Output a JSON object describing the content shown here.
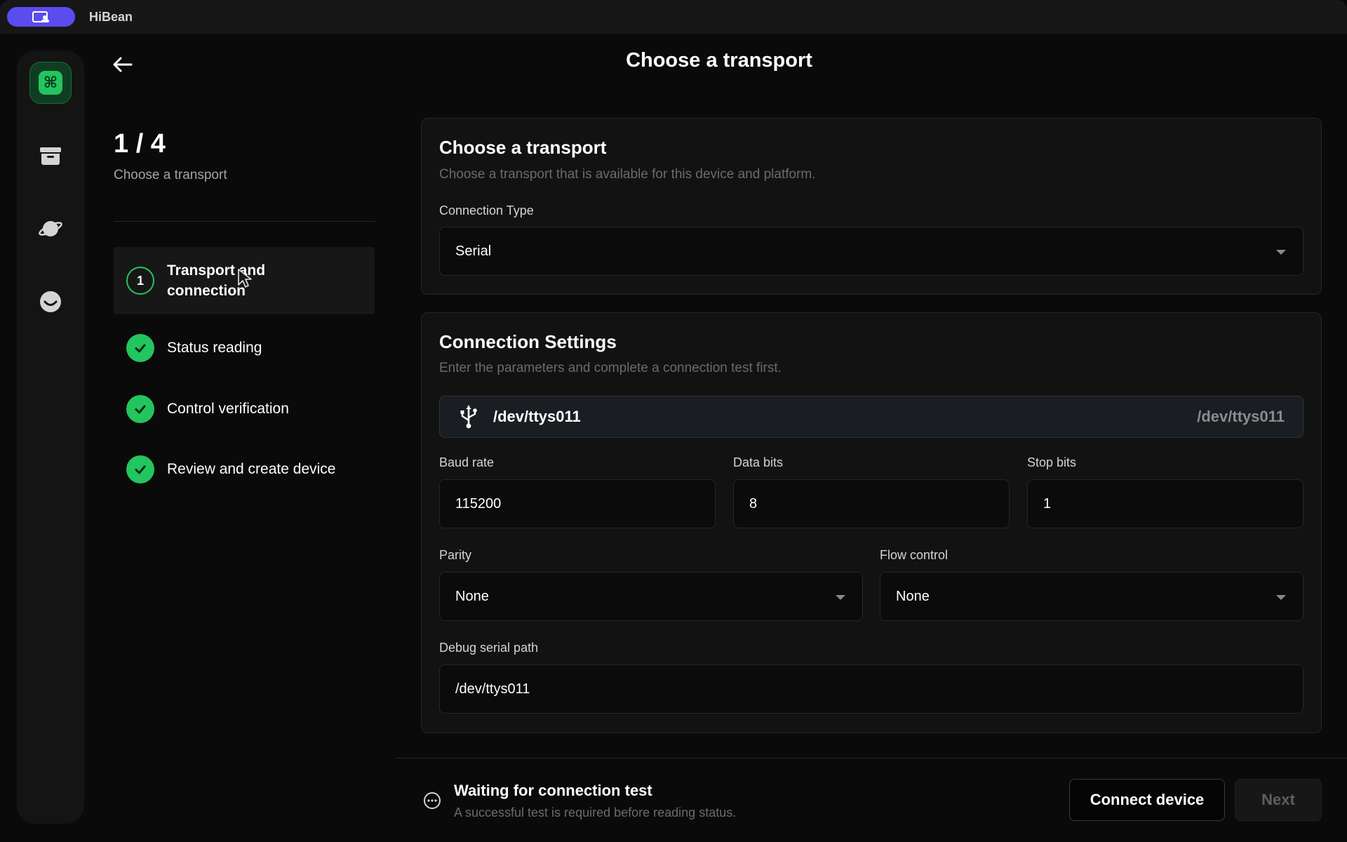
{
  "window": {
    "app_name": "HiBean"
  },
  "colors": {
    "accent_green": "#22c55e",
    "brand_purple": "#5b4cf0",
    "background": "#0a0a0a"
  },
  "rail": {
    "items": [
      {
        "icon": "command-icon",
        "active": true
      },
      {
        "icon": "archive-icon",
        "active": false
      },
      {
        "icon": "planet-icon",
        "active": false
      },
      {
        "icon": "smile-icon",
        "active": false
      }
    ]
  },
  "header": {
    "title": "Choose a transport"
  },
  "progress": {
    "counter": "1 / 4",
    "subtitle": "Choose a transport",
    "steps": [
      {
        "number": "1",
        "label": "Transport and connection",
        "state": "current"
      },
      {
        "label": "Status reading",
        "state": "done"
      },
      {
        "label": "Control verification",
        "state": "done"
      },
      {
        "label": "Review and create device",
        "state": "done"
      }
    ]
  },
  "transport_card": {
    "title": "Choose a transport",
    "subtitle": "Choose a transport that is available for this device and platform.",
    "connection_type_label": "Connection Type",
    "connection_type_value": "Serial"
  },
  "settings_card": {
    "title": "Connection Settings",
    "subtitle": "Enter the parameters and complete a connection test first.",
    "port": {
      "name": "/dev/ttys011",
      "detail": "/dev/ttys011"
    },
    "baud_rate": {
      "label": "Baud rate",
      "value": "115200"
    },
    "data_bits": {
      "label": "Data bits",
      "value": "8"
    },
    "stop_bits": {
      "label": "Stop bits",
      "value": "1"
    },
    "parity": {
      "label": "Parity",
      "value": "None"
    },
    "flow_control": {
      "label": "Flow control",
      "value": "None"
    },
    "debug_path": {
      "label": "Debug serial path",
      "value": "/dev/ttys011"
    }
  },
  "footer": {
    "status_title": "Waiting for connection test",
    "status_subtitle": "A successful test is required before reading status.",
    "connect_label": "Connect device",
    "next_label": "Next"
  }
}
